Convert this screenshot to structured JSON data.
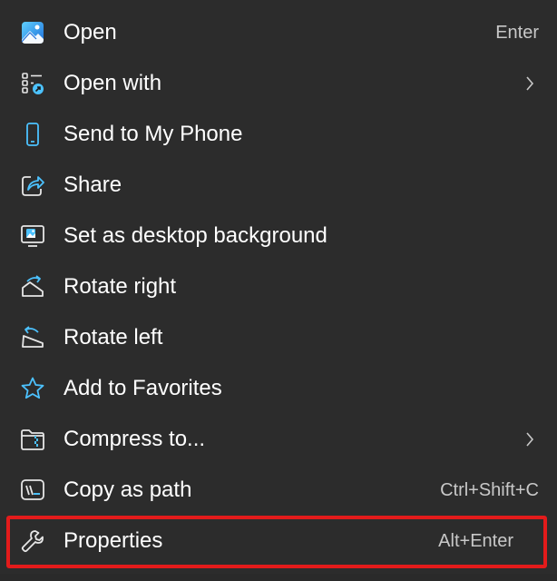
{
  "colors": {
    "background": "#2c2c2c",
    "text": "#ffffff",
    "shortcut_text": "#c8c8c8",
    "icon_accent": "#4cc2ff",
    "highlight_border": "#e31b1b"
  },
  "menu": {
    "items": [
      {
        "label": "Open",
        "shortcut": "Enter",
        "icon": "photo-app-icon",
        "has_submenu": false
      },
      {
        "label": "Open with",
        "shortcut": "",
        "icon": "open-with-icon",
        "has_submenu": true
      },
      {
        "label": "Send to My Phone",
        "shortcut": "",
        "icon": "phone-icon",
        "has_submenu": false
      },
      {
        "label": "Share",
        "shortcut": "",
        "icon": "share-icon",
        "has_submenu": false
      },
      {
        "label": "Set as desktop background",
        "shortcut": "",
        "icon": "desktop-background-icon",
        "has_submenu": false
      },
      {
        "label": "Rotate right",
        "shortcut": "",
        "icon": "rotate-right-icon",
        "has_submenu": false
      },
      {
        "label": "Rotate left",
        "shortcut": "",
        "icon": "rotate-left-icon",
        "has_submenu": false
      },
      {
        "label": "Add to Favorites",
        "shortcut": "",
        "icon": "star-icon",
        "has_submenu": false
      },
      {
        "label": "Compress to...",
        "shortcut": "",
        "icon": "zip-folder-icon",
        "has_submenu": true
      },
      {
        "label": "Copy as path",
        "shortcut": "Ctrl+Shift+C",
        "icon": "copy-path-icon",
        "has_submenu": false
      },
      {
        "label": "Properties",
        "shortcut": "Alt+Enter",
        "icon": "wrench-icon",
        "has_submenu": false
      }
    ]
  }
}
